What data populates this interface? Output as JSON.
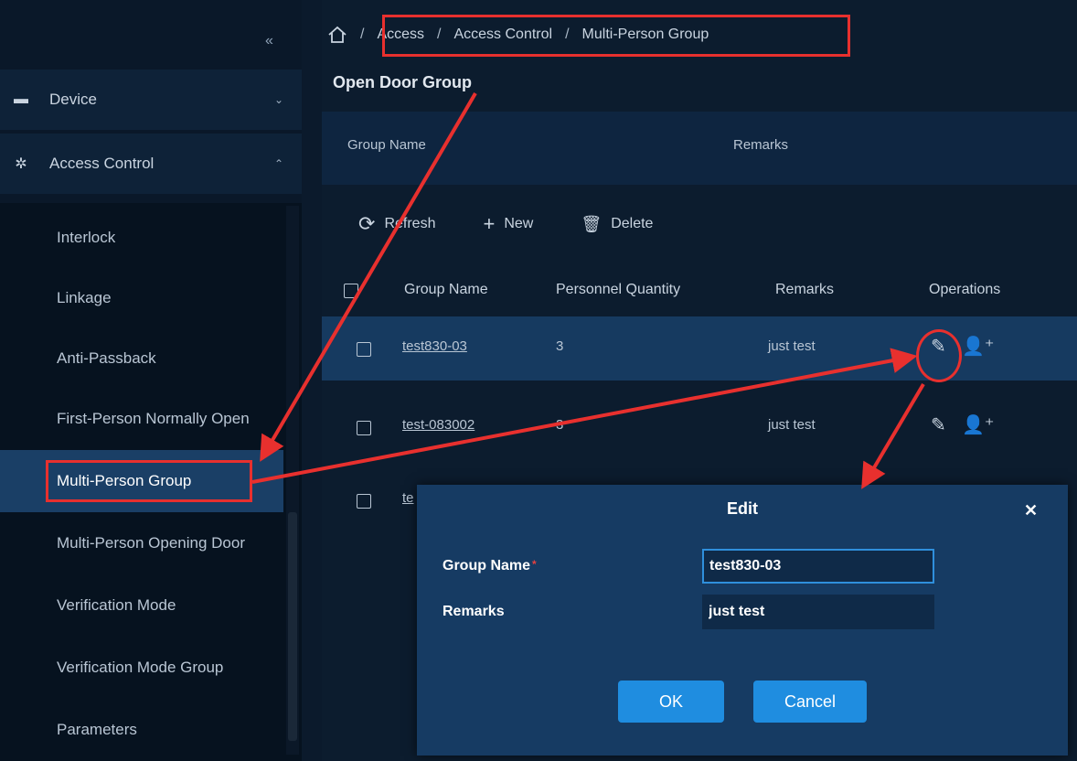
{
  "sidebar": {
    "collapse_icon": "double-chevron-left-icon",
    "groups": [
      {
        "label": "Device",
        "icon": "device-icon",
        "chevron": "chevron-down-icon"
      },
      {
        "label": "Access Control",
        "icon": "gear-icon",
        "chevron": "chevron-up-icon"
      }
    ],
    "items": [
      {
        "label": "Interlock"
      },
      {
        "label": "Linkage"
      },
      {
        "label": "Anti-Passback"
      },
      {
        "label": "First-Person Normally Open"
      },
      {
        "label": "Multi-Person Group"
      },
      {
        "label": "Multi-Person Opening Door"
      },
      {
        "label": "Verification Mode"
      },
      {
        "label": "Verification Mode Group"
      },
      {
        "label": "Parameters"
      }
    ],
    "active_item": "Multi-Person Group"
  },
  "breadcrumb": {
    "separator": "/",
    "items": [
      "Access",
      "Access Control",
      "Multi-Person Group"
    ]
  },
  "page": {
    "title": "Open Door Group",
    "search_fields": [
      "Group Name",
      "Remarks"
    ]
  },
  "toolbar": {
    "refresh": "Refresh",
    "new": "New",
    "delete": "Delete"
  },
  "table": {
    "columns": [
      "Group Name",
      "Personnel Quantity",
      "Remarks",
      "Operations"
    ],
    "rows": [
      {
        "group_name": "test830-03",
        "quantity": "3",
        "remarks": "just test",
        "selected": true
      },
      {
        "group_name": "test-083002",
        "quantity": "3",
        "remarks": "just test",
        "selected": false
      },
      {
        "group_name": "te",
        "quantity": "",
        "remarks": "",
        "selected": false
      }
    ]
  },
  "modal": {
    "title": "Edit",
    "close_icon": "close-icon",
    "fields": [
      {
        "label": "Group Name",
        "required_mark": "*",
        "value": "test830-03"
      },
      {
        "label": "Remarks",
        "value": "just test"
      }
    ],
    "ok": "OK",
    "cancel": "Cancel"
  },
  "colors": {
    "annotation": "#e8302e",
    "accent": "#1f8de0",
    "background": "#0c1c2e"
  }
}
